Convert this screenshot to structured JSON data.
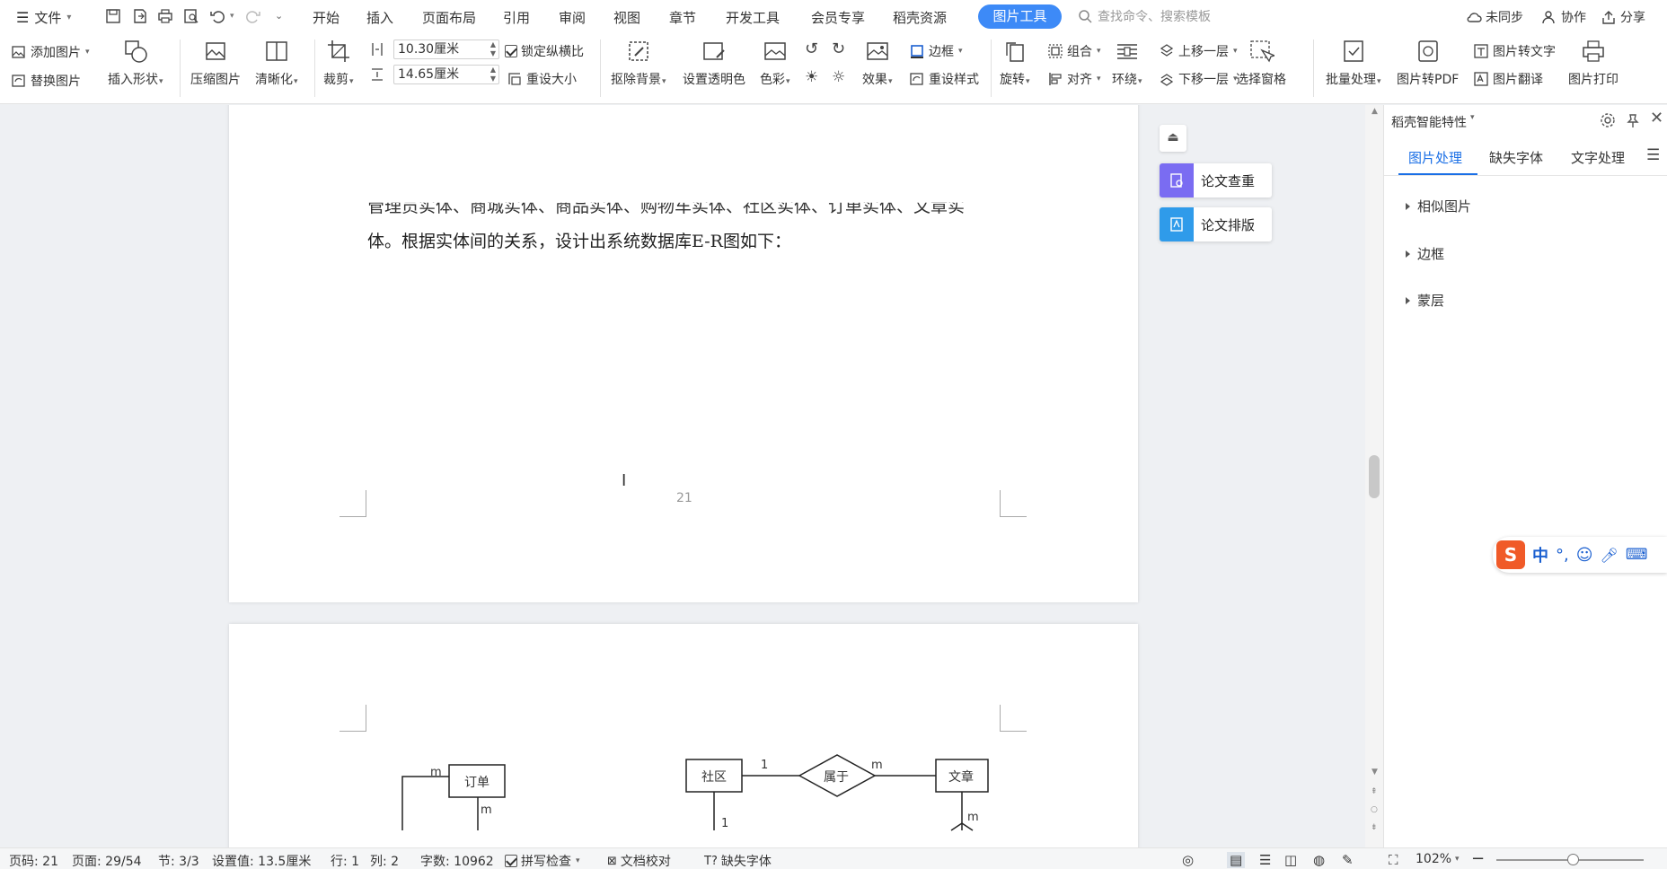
{
  "menubar": {
    "file": "文件",
    "tabs": [
      "开始",
      "插入",
      "页面布局",
      "引用",
      "审阅",
      "视图",
      "章节",
      "开发工具",
      "会员专享",
      "稻壳资源"
    ],
    "active_tab": "图片工具",
    "search_placeholder": "查找命令、搜索模板",
    "sync": "未同步",
    "collab": "协作",
    "share": "分享"
  },
  "ribbon": {
    "add_picture": "添加图片",
    "replace_picture": "替换图片",
    "insert_shape": "插入形状",
    "compress": "压缩图片",
    "sharpen": "清晰化",
    "crop": "裁剪",
    "width_value": "10.30厘米",
    "height_value": "14.65厘米",
    "lock_ratio": "锁定纵横比",
    "reset_size": "重设大小",
    "remove_bg": "抠除背景",
    "set_transparent": "设置透明色",
    "color": "色彩",
    "effects": "效果",
    "border": "边框",
    "reset_style": "重设样式",
    "rotate": "旋转",
    "group": "组合",
    "align": "对齐",
    "wrap": "环绕",
    "bring_forward": "上移一层",
    "send_backward": "下移一层",
    "selection_pane": "选择窗格",
    "batch": "批量处理",
    "to_pdf": "图片转PDF",
    "to_text": "图片转文字",
    "translate": "图片翻译",
    "print": "图片打印"
  },
  "document": {
    "line1": "管理员实体、商城实体、商品实体、购物车实体、社区实体、订单实体、文章实",
    "line2": "体。根据实体间的关系，设计出系统数据库E-R图如下：",
    "page_number": "21",
    "er": {
      "order": "订单",
      "community": "社区",
      "belongs": "属于",
      "article": "文章",
      "m": "m",
      "one": "1"
    }
  },
  "side_buttons": {
    "check": "论文查重",
    "format": "论文排版"
  },
  "right_panel": {
    "title": "稻壳智能特性",
    "tabs": [
      "图片处理",
      "缺失字体",
      "文字处理"
    ],
    "items": [
      "相似图片",
      "边框",
      "蒙层"
    ]
  },
  "statusbar": {
    "page_code": "页码: 21",
    "page": "页面: 29/54",
    "section": "节: 3/3",
    "setting": "设置值: 13.5厘米",
    "row": "行: 1",
    "col": "列: 2",
    "words": "字数: 10962",
    "spell": "拼写检查",
    "proof": "文档校对",
    "missing_font": "缺失字体",
    "zoom": "102%"
  },
  "ime": {
    "mode": "中"
  }
}
